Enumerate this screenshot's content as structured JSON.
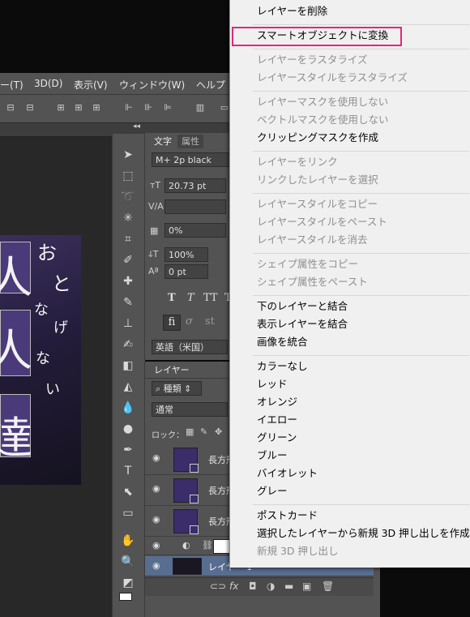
{
  "menubar": {
    "items": [
      "ー(T)",
      "3D(D)",
      "表示(V)",
      "ウィンドウ(W)",
      "ヘルプ"
    ]
  },
  "canvas": {
    "headline_chars": [
      "人",
      "人",
      "達"
    ],
    "vertical_text": [
      "お",
      "と",
      "な",
      "げ",
      "な",
      "い"
    ]
  },
  "panels": {
    "collapse_arrows": "◂◂",
    "char_tabs": [
      "文字",
      "属性"
    ],
    "font_family": "M+ 2p black",
    "font_size": "20.73 pt",
    "tracking": "0%",
    "vertical_scale": "100%",
    "baseline_shift": "0 pt",
    "language": "英語（米国）",
    "typo_buttons": [
      "T",
      "T",
      "TT",
      "Tr"
    ],
    "ot_buttons": [
      "fi",
      "σ",
      "st"
    ]
  },
  "layers": {
    "tab_label": "レイヤー",
    "filter_kind": "種類",
    "blend_mode": "通常",
    "lock_label": "ロック：",
    "rows": [
      {
        "name": "長方形"
      },
      {
        "name": "長方形"
      },
      {
        "name": "長方形"
      },
      {
        "name": ""
      },
      {
        "name": "レイヤー 1"
      }
    ],
    "footer_icons": [
      "link-icon",
      "fx-icon",
      "mask-icon",
      "adjustment-icon",
      "folder-icon",
      "new-layer-icon",
      "trash-icon"
    ]
  },
  "context_menu": {
    "groups": [
      [
        {
          "label": "レイヤーを削除",
          "enabled": true
        }
      ],
      [
        {
          "label": "スマートオブジェクトに変換",
          "enabled": true,
          "highlighted": true
        }
      ],
      [
        {
          "label": "レイヤーをラスタライズ",
          "enabled": false
        },
        {
          "label": "レイヤースタイルをラスタライズ",
          "enabled": false
        }
      ],
      [
        {
          "label": "レイヤーマスクを使用しない",
          "enabled": false
        },
        {
          "label": "ベクトルマスクを使用しない",
          "enabled": false
        },
        {
          "label": "クリッピングマスクを作成",
          "enabled": true
        }
      ],
      [
        {
          "label": "レイヤーをリンク",
          "enabled": false
        },
        {
          "label": "リンクしたレイヤーを選択",
          "enabled": false
        }
      ],
      [
        {
          "label": "レイヤースタイルをコピー",
          "enabled": false
        },
        {
          "label": "レイヤースタイルをペースト",
          "enabled": false
        },
        {
          "label": "レイヤースタイルを消去",
          "enabled": false
        }
      ],
      [
        {
          "label": "シェイプ属性をコピー",
          "enabled": false
        },
        {
          "label": "シェイプ属性をペースト",
          "enabled": false
        }
      ],
      [
        {
          "label": "下のレイヤーと結合",
          "enabled": true
        },
        {
          "label": "表示レイヤーを結合",
          "enabled": true
        },
        {
          "label": "画像を統合",
          "enabled": true
        }
      ],
      [
        {
          "label": "カラーなし",
          "enabled": true
        },
        {
          "label": "レッド",
          "enabled": true
        },
        {
          "label": "オレンジ",
          "enabled": true
        },
        {
          "label": "イエロー",
          "enabled": true
        },
        {
          "label": "グリーン",
          "enabled": true
        },
        {
          "label": "ブルー",
          "enabled": true
        },
        {
          "label": "バイオレット",
          "enabled": true
        },
        {
          "label": "グレー",
          "enabled": true
        }
      ],
      [
        {
          "label": "ポストカード",
          "enabled": true
        },
        {
          "label": "選択したレイヤーから新規 3D 押し出しを作成",
          "enabled": true
        },
        {
          "label": "新規 3D 押し出し",
          "enabled": false
        }
      ]
    ]
  },
  "colors": {
    "highlight_border": "#e2287a",
    "panel_bg": "#535353",
    "selected_layer": "#586e90"
  }
}
